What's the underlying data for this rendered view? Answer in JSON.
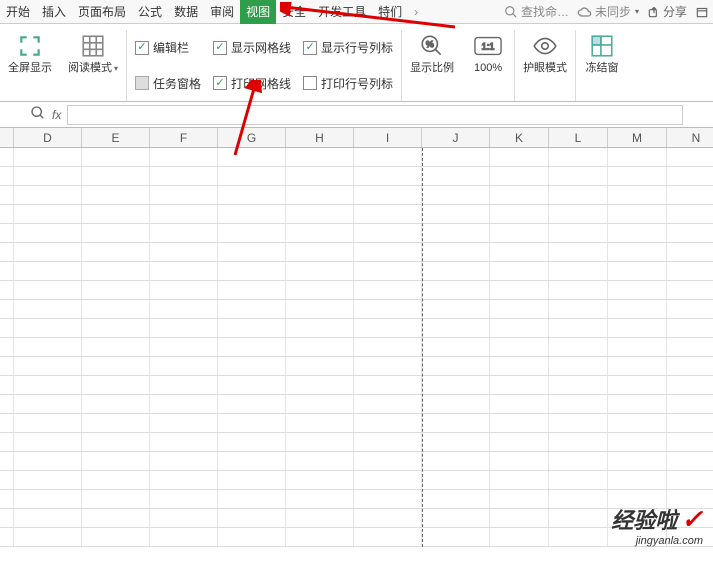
{
  "tabs": {
    "items": [
      "开始",
      "插入",
      "页面布局",
      "公式",
      "数据",
      "审阅",
      "视图",
      "安全",
      "开发工具",
      "特们"
    ],
    "activeIndex": 6,
    "moreGlyph": "›"
  },
  "topRight": {
    "search_placeholder": "查找命…",
    "sync_status": "未同步",
    "share_label": "分享"
  },
  "ribbon": {
    "fullscreen_label": "全屏显示",
    "reading_label": "阅读模式",
    "checks": {
      "formula_bar": {
        "label": "编辑栏",
        "checked": true
      },
      "task_pane": {
        "label": "任务窗格",
        "checked": false
      },
      "show_grid": {
        "label": "显示网格线",
        "checked": true
      },
      "print_grid": {
        "label": "打印网格线",
        "checked": true
      },
      "show_headers": {
        "label": "显示行号列标",
        "checked": true
      },
      "print_headers": {
        "label": "打印行号列标",
        "checked": false
      }
    },
    "zoom_label": "显示比例",
    "hundred_label": "100%",
    "eye_label": "护眼模式",
    "freeze_label": "冻结窗"
  },
  "formula": {
    "fx_label": "fx",
    "value": ""
  },
  "columns": {
    "widths": [
      68,
      68,
      68,
      68,
      68,
      68,
      68,
      59,
      59,
      59,
      59,
      59,
      59
    ],
    "labels": [
      "D",
      "E",
      "F",
      "G",
      "H",
      "I",
      "J",
      "K",
      "L",
      "M",
      "N"
    ]
  },
  "grid": {
    "rowCount": 21,
    "pageBreakCol": 6
  },
  "watermark": {
    "main": "经验啦",
    "sub": "jingyanla.com"
  }
}
